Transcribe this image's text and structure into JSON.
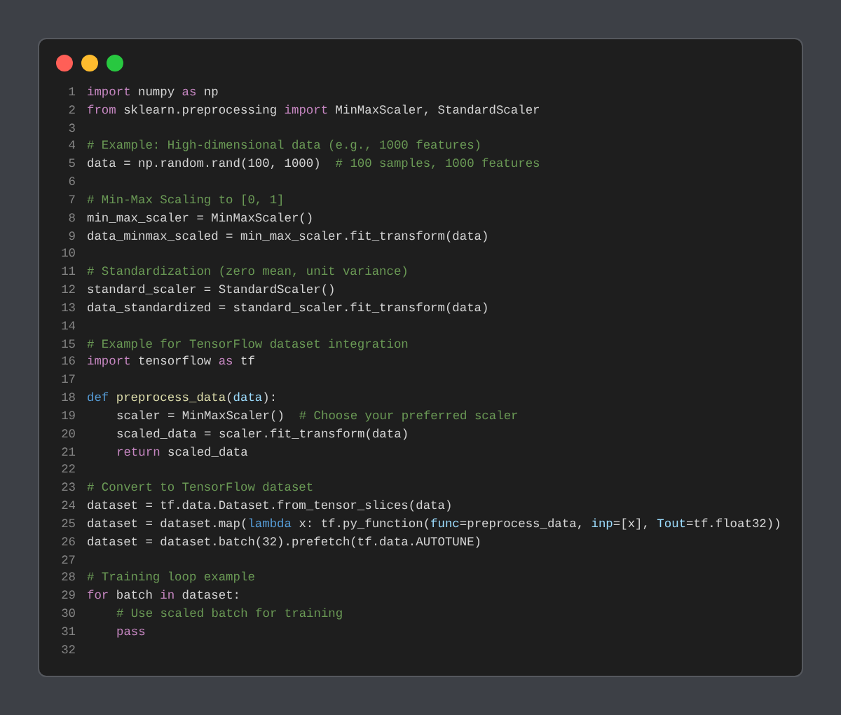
{
  "window": {
    "controls": [
      {
        "kind": "close"
      },
      {
        "kind": "minimize"
      },
      {
        "kind": "maximize"
      }
    ]
  },
  "lines": [
    {
      "number": "1",
      "tokens": [
        {
          "kind": "kw",
          "text": "import"
        },
        {
          "kind": "plain",
          "text": " numpy "
        },
        {
          "kind": "kw",
          "text": "as"
        },
        {
          "kind": "plain",
          "text": " np"
        }
      ]
    },
    {
      "number": "2",
      "tokens": [
        {
          "kind": "kw",
          "text": "from"
        },
        {
          "kind": "plain",
          "text": " sklearn.preprocessing "
        },
        {
          "kind": "kw",
          "text": "import"
        },
        {
          "kind": "plain",
          "text": " MinMaxScaler, StandardScaler"
        }
      ]
    },
    {
      "number": "3"
    },
    {
      "number": "4",
      "tokens": [
        {
          "kind": "comment",
          "text": "# Example: High-dimensional data (e.g., 1000 features)"
        }
      ]
    },
    {
      "number": "5",
      "tokens": [
        {
          "kind": "plain",
          "text": "data = np.random.rand(100, 1000)  "
        },
        {
          "kind": "comment",
          "text": "# 100 samples, 1000 features"
        }
      ]
    },
    {
      "number": "6"
    },
    {
      "number": "7",
      "tokens": [
        {
          "kind": "comment",
          "text": "# Min-Max Scaling to [0, 1]"
        }
      ]
    },
    {
      "number": "8",
      "tokens": [
        {
          "kind": "plain",
          "text": "min_max_scaler = MinMaxScaler()"
        }
      ]
    },
    {
      "number": "9",
      "tokens": [
        {
          "kind": "plain",
          "text": "data_minmax_scaled = min_max_scaler.fit_transform(data)"
        }
      ]
    },
    {
      "number": "10"
    },
    {
      "number": "11",
      "tokens": [
        {
          "kind": "comment",
          "text": "# Standardization (zero mean, unit variance)"
        }
      ]
    },
    {
      "number": "12",
      "tokens": [
        {
          "kind": "plain",
          "text": "standard_scaler = StandardScaler()"
        }
      ]
    },
    {
      "number": "13",
      "tokens": [
        {
          "kind": "plain",
          "text": "data_standardized = standard_scaler.fit_transform(data)"
        }
      ]
    },
    {
      "number": "14"
    },
    {
      "number": "15",
      "tokens": [
        {
          "kind": "comment",
          "text": "# Example for TensorFlow dataset integration"
        }
      ]
    },
    {
      "number": "16",
      "tokens": [
        {
          "kind": "kw",
          "text": "import"
        },
        {
          "kind": "plain",
          "text": " tensorflow "
        },
        {
          "kind": "kw",
          "text": "as"
        },
        {
          "kind": "plain",
          "text": " tf"
        }
      ]
    },
    {
      "number": "17"
    },
    {
      "number": "18",
      "tokens": [
        {
          "kind": "def",
          "text": "def"
        },
        {
          "kind": "fn",
          "text": " preprocess_data"
        },
        {
          "kind": "plain",
          "text": "("
        },
        {
          "kind": "param",
          "text": "data"
        },
        {
          "kind": "plain",
          "text": "):"
        }
      ]
    },
    {
      "number": "19",
      "indented": true,
      "tokens": [
        {
          "kind": "plain",
          "text": "scaler = MinMaxScaler()  "
        },
        {
          "kind": "comment",
          "text": "# Choose your preferred scaler"
        }
      ]
    },
    {
      "number": "20",
      "indented": true,
      "tokens": [
        {
          "kind": "plain",
          "text": "scaled_data = scaler.fit_transform(data)"
        }
      ]
    },
    {
      "number": "21",
      "indented": true,
      "tokens": [
        {
          "kind": "kw",
          "text": "return"
        },
        {
          "kind": "plain",
          "text": " scaled_data"
        }
      ]
    },
    {
      "number": "22"
    },
    {
      "number": "23",
      "tokens": [
        {
          "kind": "comment",
          "text": "# Convert to TensorFlow dataset"
        }
      ]
    },
    {
      "number": "24",
      "tokens": [
        {
          "kind": "plain",
          "text": "dataset = tf.data.Dataset.from_tensor_slices(data)"
        }
      ]
    },
    {
      "number": "25",
      "tokens": [
        {
          "kind": "plain",
          "text": "dataset = dataset.map("
        },
        {
          "kind": "def",
          "text": "lambda"
        },
        {
          "kind": "plain",
          "text": " x: tf.py_function("
        },
        {
          "kind": "param",
          "text": "func"
        },
        {
          "kind": "plain",
          "text": "=preprocess_data, "
        },
        {
          "kind": "param",
          "text": "inp"
        },
        {
          "kind": "plain",
          "text": "=[x], "
        },
        {
          "kind": "param",
          "text": "Tout"
        },
        {
          "kind": "plain",
          "text": "=tf.float32))"
        }
      ]
    },
    {
      "number": "26",
      "tokens": [
        {
          "kind": "plain",
          "text": "dataset = dataset.batch(32).prefetch(tf.data.AUTOTUNE)"
        }
      ]
    },
    {
      "number": "27"
    },
    {
      "number": "28",
      "tokens": [
        {
          "kind": "comment",
          "text": "# Training loop example"
        }
      ]
    },
    {
      "number": "29",
      "tokens": [
        {
          "kind": "kw",
          "text": "for"
        },
        {
          "kind": "plain",
          "text": " batch "
        },
        {
          "kind": "kw",
          "text": "in"
        },
        {
          "kind": "plain",
          "text": " dataset:"
        }
      ]
    },
    {
      "number": "30",
      "indented": true,
      "tokens": [
        {
          "kind": "comment",
          "text": "# Use scaled batch for training"
        }
      ]
    },
    {
      "number": "31",
      "indented": true,
      "tokens": [
        {
          "kind": "kw",
          "text": "pass"
        }
      ]
    },
    {
      "number": "32"
    }
  ]
}
